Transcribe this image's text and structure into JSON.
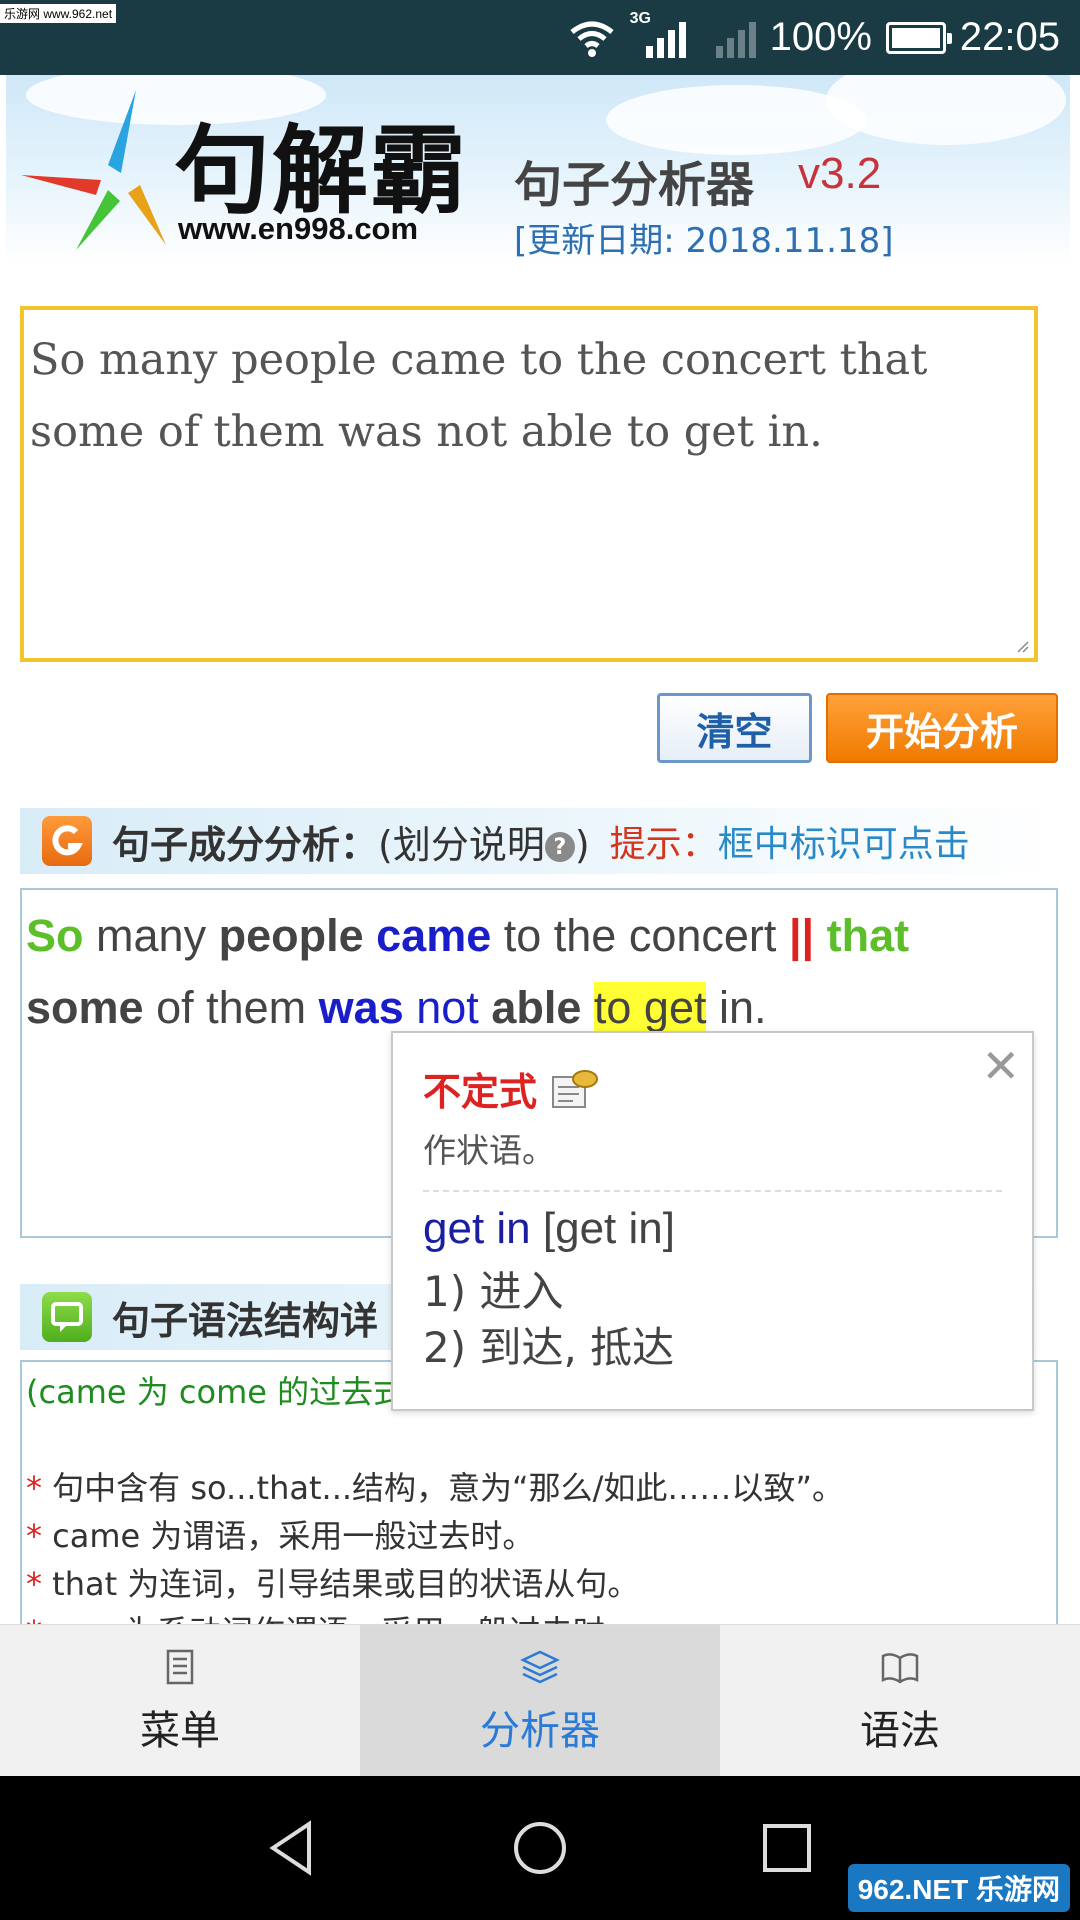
{
  "watermark_top": "乐游网 www.962.net",
  "status_bar": {
    "network": "3G",
    "battery": "100%",
    "time": "22:05"
  },
  "header": {
    "brand": "句解霸",
    "site": "www.en998.com",
    "subtitle": "句子分析器",
    "version": "v3.2",
    "update": "[更新日期: 2018.11.18]"
  },
  "input": {
    "value": "So many people came to the concert that some of them was not able to get in."
  },
  "buttons": {
    "clear": "清空",
    "start": "开始分析"
  },
  "analysis_section": {
    "title": "句子成分分析：",
    "paren_open": "(划分说明",
    "paren_close": ")",
    "hint_label": "提示：",
    "hint": "框中标识可点击"
  },
  "analysis_words": {
    "w1": "So",
    "w2": "many",
    "w3": "people",
    "w4": "came",
    "w5": "to the concert",
    "sep": "||",
    "w6": "that",
    "w7": "some",
    "w8": "of them",
    "w9": "was",
    "w10": "not",
    "w11": "able",
    "w12": "to get",
    "w13": "in."
  },
  "popup": {
    "type": "不定式",
    "role": "作状语。",
    "phrase": "get in",
    "pron": "[get in]",
    "meanings": [
      "1) 进入",
      "2) 到达, 抵达"
    ],
    "close": "✕"
  },
  "grammar_section": {
    "title": "句子语法结构详",
    "note": "(came 为 come 的过去式",
    "items": [
      "句中含有 so...that...结构，意为“那么/如此……以致”。",
      "came 为谓语，采用一般过去时。",
      "that 为连词，引导结果或目的状语从句。",
      "was 为系动词作谓语，采用一般过去时。"
    ]
  },
  "tabs": [
    {
      "label": "菜单",
      "icon": "list-icon"
    },
    {
      "label": "分析器",
      "icon": "layers-icon"
    },
    {
      "label": "语法",
      "icon": "book-icon"
    }
  ],
  "watermark_bottom": "962.NET 乐游网",
  "colors": {
    "accent_orange": "#f07a00",
    "active_tab": "#2b7bd6",
    "highlight": "#ffff33",
    "input_border": "#f2c52e"
  }
}
